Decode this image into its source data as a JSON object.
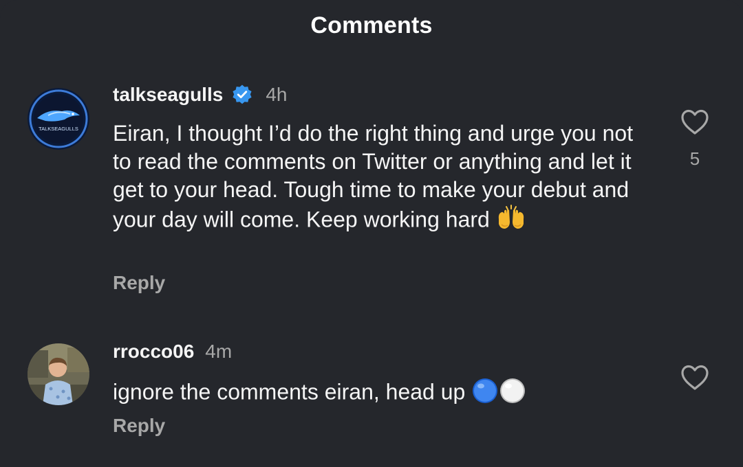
{
  "header": {
    "title": "Comments"
  },
  "comments": [
    {
      "username": "talkseagulls",
      "verified": true,
      "time": "4h",
      "avatar_text": "TALKSEAGULLS",
      "text": "Eiran, I thought I’d do the right thing and urge you not to read the comments on Twitter or anything and let it get to your head. Tough time to make your debut and your day will come. Keep working hard",
      "emoji": "raising-hands",
      "reply_label": "Reply",
      "like_count": "5"
    },
    {
      "username": "rrocco06",
      "verified": false,
      "time": "4m",
      "text": "ignore the comments eiran, head up",
      "emoji": "blue-circle white-circle",
      "reply_label": "Reply"
    }
  ],
  "colors": {
    "background": "#25272c",
    "primary_text": "#f5f5f5",
    "secondary_text": "#a8a8a8",
    "verified_blue": "#3897f0"
  },
  "icons": [
    "verified-badge-icon",
    "heart-icon"
  ]
}
